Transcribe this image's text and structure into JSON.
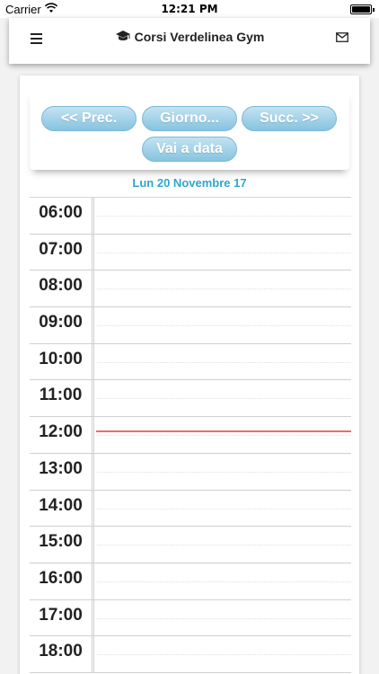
{
  "status_bar": {
    "carrier": "Carrier",
    "time": "12:21 PM"
  },
  "header": {
    "title": "Corsi Verdelinea Gym",
    "icons": [
      "menu-icon",
      "graduation-cap-icon",
      "mail-icon"
    ]
  },
  "toolbar": {
    "prev_label": "<< Prec.",
    "day_label": "Giorno...",
    "next_label": "Succ. >>",
    "goto_label": "Vai a data"
  },
  "date_label": "Lun 20 Novembre 17",
  "calendar": {
    "hours": [
      "06:00",
      "07:00",
      "08:00",
      "09:00",
      "10:00",
      "11:00",
      "12:00",
      "13:00",
      "14:00",
      "15:00",
      "16:00",
      "17:00",
      "18:00"
    ],
    "now_line_color": "#ef6a6a"
  },
  "colors": {
    "accent": "#2fa6d0",
    "button_top": "#c4e3f2",
    "button_bottom": "#86c3e0"
  }
}
